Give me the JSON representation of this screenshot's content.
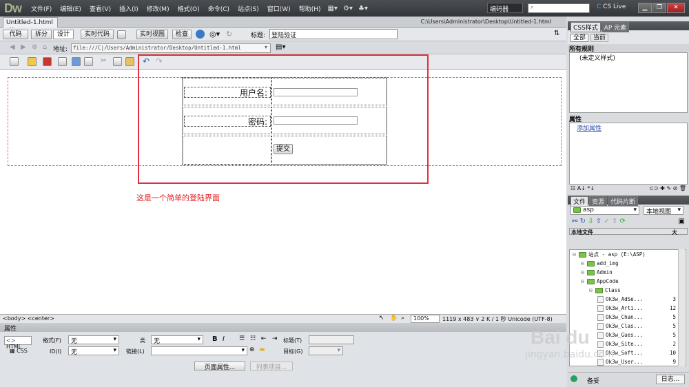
{
  "app": {
    "logo": "Dw",
    "workspace": "编码器",
    "cs_live": "CS Live"
  },
  "menus": [
    "文件(F)",
    "编辑(E)",
    "查看(V)",
    "插入(I)",
    "修改(M)",
    "格式(O)",
    "命令(C)",
    "站点(S)",
    "窗口(W)",
    "帮助(H)"
  ],
  "document": {
    "tab": "Untitled-1.html",
    "path": "C:\\Users\\Administrator\\Desktop\\Untitled-1.html"
  },
  "view_buttons": {
    "code": "代码",
    "split": "拆分",
    "design": "设计",
    "live_code": "实时代码",
    "live_view": "实时视图",
    "inspect": "检查"
  },
  "title_label": "标题:",
  "title_value": "登陆验证",
  "address": {
    "label": "地址:",
    "value": "file:///C|/Users/Administrator/Desktop/Untitled-1.html"
  },
  "form": {
    "username_label": "用户名:",
    "password_label": "密码:",
    "submit": "提交"
  },
  "annotation": "这是一个简单的登陆界面",
  "status": {
    "tags": "<body> <center>",
    "zoom": "100%",
    "info": "1119 x 483 ∨ 2 K / 1 秒 Unicode (UTF-8)"
  },
  "properties": {
    "header": "属性",
    "html": "HTML",
    "css": "CSS",
    "format_label": "格式(F)",
    "format_value": "无",
    "class_label": "类",
    "class_value": "无",
    "id_label": "ID(I)",
    "id_value": "无",
    "link_label": "链接(L)",
    "title_label": "标题(T)",
    "target_label": "目标(G)",
    "page_props": "页面属性...",
    "list_item": "列表项目..."
  },
  "css_panel": {
    "tab1": "CSS样式",
    "tab2": "AP 元素",
    "all": "全部",
    "current": "当前",
    "all_rules": "所有规则",
    "rule": "(未定义样式)",
    "props": "属性",
    "add_prop": "添加属性"
  },
  "files_panel": {
    "tab1": "文件",
    "tab2": "资源",
    "tab3": "代码片断",
    "site": "asp",
    "view": "本地视图",
    "header": "本地文件",
    "header2": "大",
    "items": [
      {
        "name": "站点 - asp (E:\\ASP)",
        "indent": 0,
        "type": "folder",
        "size": ""
      },
      {
        "name": "add_img",
        "indent": 1,
        "type": "folder",
        "size": ""
      },
      {
        "name": "Admin",
        "indent": 1,
        "type": "folder",
        "size": ""
      },
      {
        "name": "AppCode",
        "indent": 1,
        "type": "folder",
        "size": ""
      },
      {
        "name": "Class",
        "indent": 2,
        "type": "folder",
        "size": ""
      },
      {
        "name": "Ok3w_AdSe...",
        "indent": 3,
        "type": "file",
        "size": "3"
      },
      {
        "name": "Ok3w_Arti...",
        "indent": 3,
        "type": "file",
        "size": "12"
      },
      {
        "name": "Ok3w_Chan...",
        "indent": 3,
        "type": "file",
        "size": "5"
      },
      {
        "name": "Ok3w_Clas...",
        "indent": 3,
        "type": "file",
        "size": "5"
      },
      {
        "name": "Ok3w_Gues...",
        "indent": 3,
        "type": "file",
        "size": "5"
      },
      {
        "name": "Ok3w_Site...",
        "indent": 3,
        "type": "file",
        "size": "2"
      },
      {
        "name": "Ok3w_Soft...",
        "indent": 3,
        "type": "file",
        "size": "10"
      },
      {
        "name": "Ok3w_User...",
        "indent": 3,
        "type": "file",
        "size": "9"
      }
    ],
    "bottom_ready": "备妥",
    "bottom_log": "日志..."
  },
  "watermark": "Bai du",
  "watermark_sub": "jingyan.baidu.com",
  "colors": {
    "menubar": "#3f4246",
    "annotation": "#e02020",
    "highlight": "#e03040"
  }
}
